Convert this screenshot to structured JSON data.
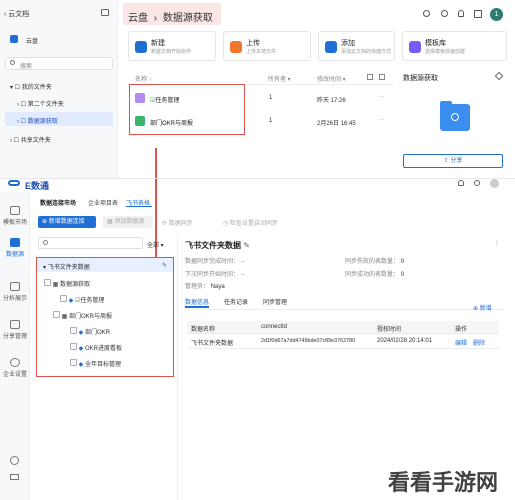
{
  "top": {
    "sidebar_title": "云文档",
    "drive": "云盘",
    "search": "搜索",
    "my_folder": "我的文件夹",
    "second_folder": "第二个文件夹",
    "data_folder": "数据源获取",
    "shared_folder": "共享文件夹",
    "breadcrumb_root": "云盘",
    "breadcrumb_current": "数据源获取",
    "avatar": "1",
    "cards": [
      {
        "title": "新建",
        "desc": "新建文档开始协作"
      },
      {
        "title": "上传",
        "desc": "上传本地文件"
      },
      {
        "title": "添加",
        "desc": "添加云文档的快捷方式"
      },
      {
        "title": "模板库",
        "desc": "选择模板快速创建"
      }
    ],
    "columns": {
      "name": "名称",
      "owner": "所有者",
      "modified": "修改时间"
    },
    "sort_arrow": "↑",
    "rows": [
      {
        "name": "任务管理",
        "owner": "1",
        "time": "昨天 17:26",
        "more": "···"
      },
      {
        "name": "部门OKR与周报",
        "owner": "1",
        "time": "2月26日 16:45",
        "more": "···"
      }
    ],
    "panel_title": "数据源获取",
    "share_btn": "分享"
  },
  "app": {
    "brand": "E数通",
    "top_tabs": [
      "数据连接市场",
      "企业项目表",
      "飞书表格"
    ],
    "sidebar": [
      "模板市场",
      "数据源",
      "分析展示",
      "分享管理",
      "企业设置"
    ],
    "toolbar": {
      "new_conn": "新增数据连接",
      "add_data": "添加数据源",
      "sync_now": "数据同步",
      "auto_sync": "检查设置自动同步"
    },
    "tree_filter": "全部",
    "tree_root": "飞书文件夹数据",
    "tree": [
      {
        "label": "数据源获取",
        "level": 1
      },
      {
        "label": "任务管理",
        "level": 2
      },
      {
        "label": "部门OKR与周报",
        "level": 2
      },
      {
        "label": "部门OKR",
        "level": 3
      },
      {
        "label": "OKR进度看板",
        "level": 3
      },
      {
        "label": "全年目标管理",
        "level": 3
      }
    ],
    "detail_title": "飞书文件夹数据",
    "meta": {
      "last_sync_label": "数据同步完成时间：",
      "last_sync_value": "--",
      "next_sync_label": "下次同步开始时间：",
      "next_sync_value": "--",
      "manager_label": "管理员：",
      "manager_value": "Naya",
      "fail_label": "同步失败的表数量：",
      "fail_value": "0",
      "success_label": "同步成功的表数量：",
      "success_value": "0"
    },
    "tabs": [
      "数据信息",
      "任务记录",
      "同步管理"
    ],
    "add_link": "新增",
    "table_cols": [
      "数据名称",
      "connectId",
      "授权时间",
      "操作"
    ],
    "table_row": {
      "name": "飞书文件夹数据",
      "id": "2d1f0d67a7dd4749bde07c89e3762780",
      "time": "2024/02/28 20:14:01",
      "edit": "编辑",
      "del": "删除"
    }
  },
  "watermark": "看看手游网"
}
